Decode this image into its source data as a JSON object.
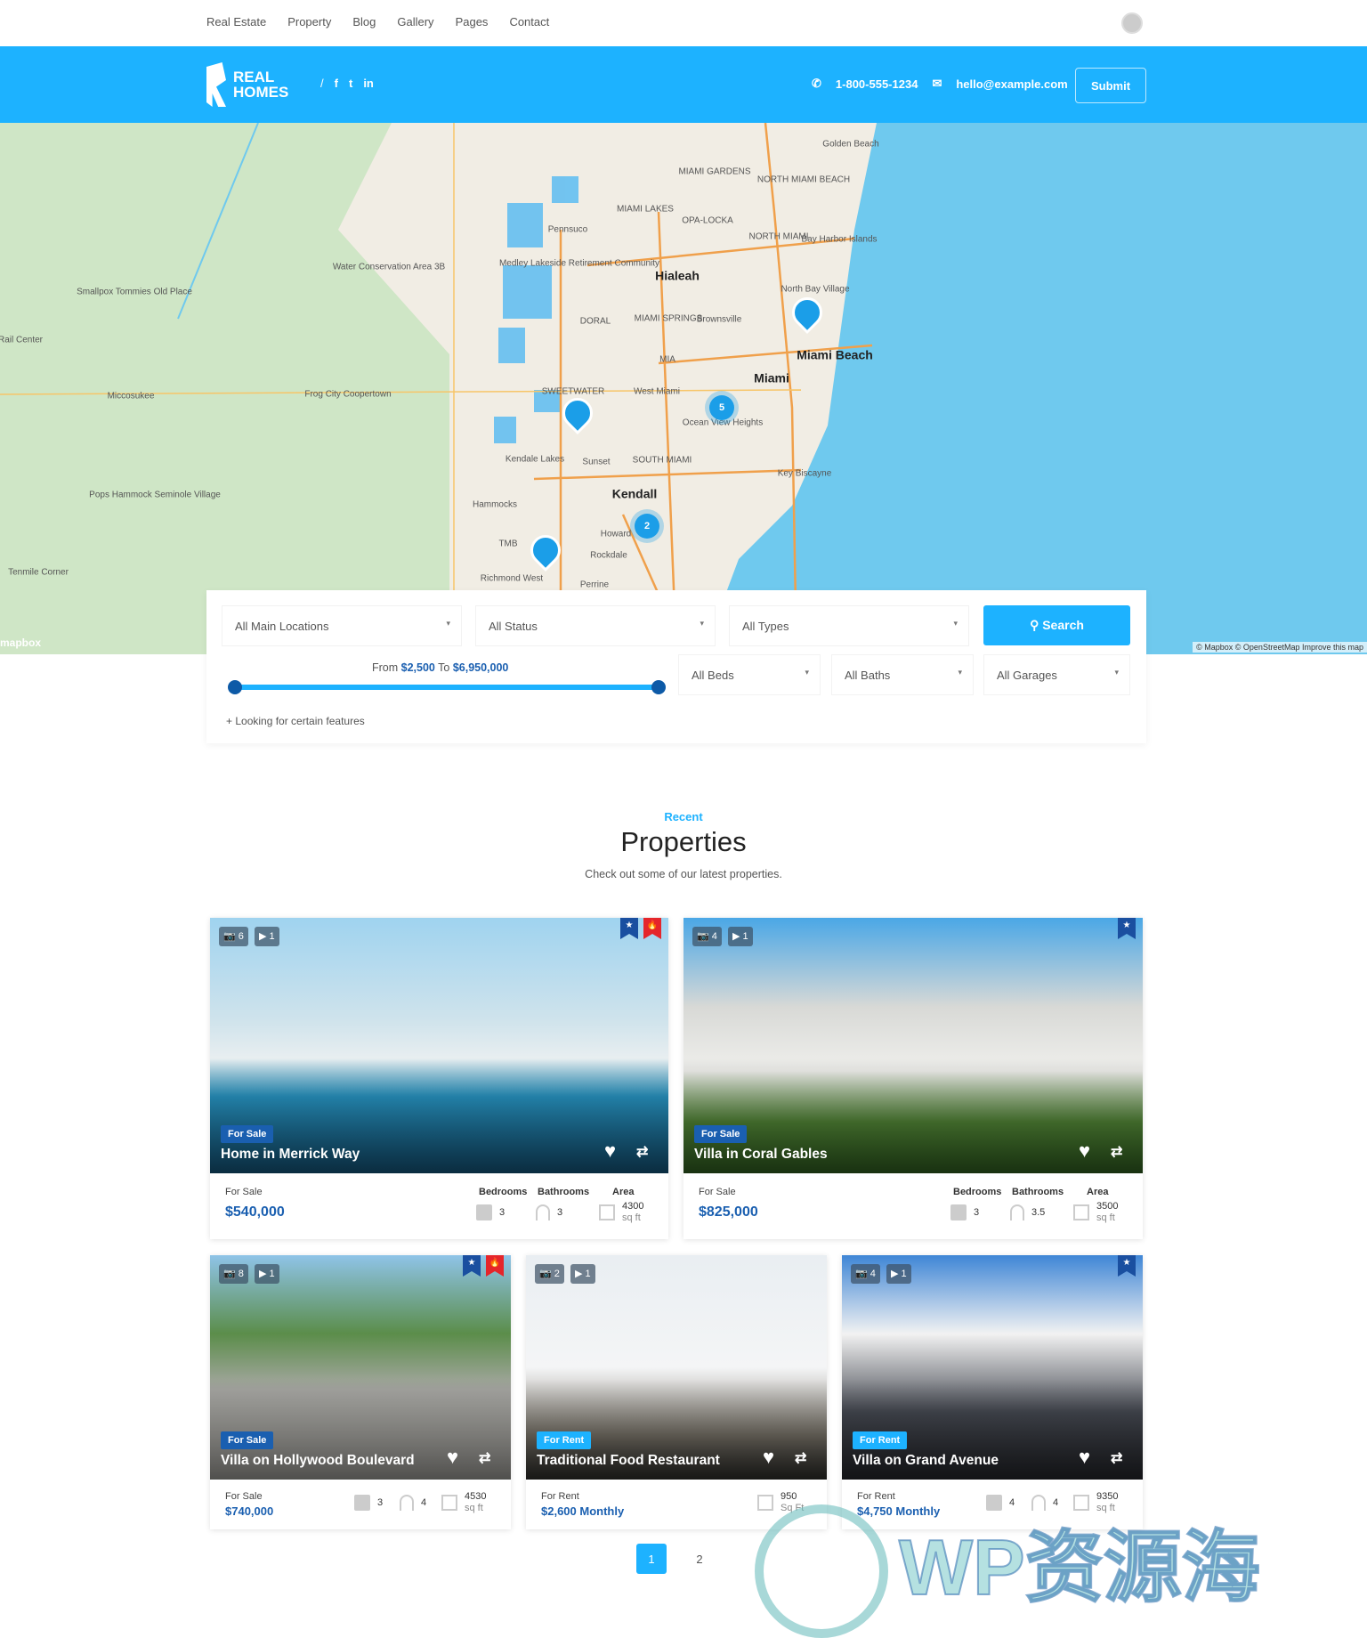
{
  "topnav": {
    "items": [
      "Real Estate",
      "Property",
      "Blog",
      "Gallery",
      "Pages",
      "Contact"
    ]
  },
  "header": {
    "logo_text": [
      "REAL",
      "HOMES"
    ],
    "social": [
      "facebook-icon",
      "twitter-icon",
      "linkedin-icon"
    ],
    "phone": "1-800-555-1234",
    "email": "hello@example.com",
    "submit": "Submit",
    "color": "#1db2ff"
  },
  "map": {
    "labels": [
      {
        "t": "Golden Beach"
      },
      {
        "t": "MIAMI GARDENS"
      },
      {
        "t": "NORTH MIAMI BEACH"
      },
      {
        "t": "MIAMI LAKES"
      },
      {
        "t": "OPA-LOCKA"
      },
      {
        "t": "Pennsuco"
      },
      {
        "t": "NORTH MIAMI"
      },
      {
        "t": "Bay Harbor Islands"
      },
      {
        "t": "Medley Lakeside Retirement Community"
      },
      {
        "t": "Water Conservation Area 3B"
      },
      {
        "t": "Hialeah"
      },
      {
        "t": "Smallpox Tommies Old Place"
      },
      {
        "t": "North Bay Village"
      },
      {
        "t": "MIAMI SPRINGS"
      },
      {
        "t": "Brownsville"
      },
      {
        "t": "DORAL"
      },
      {
        "t": "Rail Center"
      },
      {
        "t": "Miami Beach"
      },
      {
        "t": "Miami"
      },
      {
        "t": "MIA"
      },
      {
        "t": "West Miami"
      },
      {
        "t": "SWEETWATER"
      },
      {
        "t": "Miccosukee"
      },
      {
        "t": "Frog City Coopertown"
      },
      {
        "t": "Ocean View Heights"
      },
      {
        "t": "Kendale Lakes"
      },
      {
        "t": "Sunset"
      },
      {
        "t": "SOUTH MIAMI"
      },
      {
        "t": "Key Biscayne"
      },
      {
        "t": "Pops Hammock Seminole Village"
      },
      {
        "t": "Kendall"
      },
      {
        "t": "Hammocks"
      },
      {
        "t": "Howard"
      },
      {
        "t": "TMB"
      },
      {
        "t": "Rockdale"
      },
      {
        "t": "Tenmile Corner"
      },
      {
        "t": "Richmond West"
      },
      {
        "t": "Perrine"
      }
    ],
    "clusters": [
      "5",
      "2"
    ],
    "attribution": "© Mapbox © OpenStreetMap Improve this map",
    "brand": "mapbox"
  },
  "search": {
    "locations": "All Main Locations",
    "status": "All Status",
    "types": "All Types",
    "button": "Search",
    "range_from_label": "From",
    "range_min": "$2,500",
    "range_to_label": "To",
    "range_max": "$6,950,000",
    "beds": "All Beds",
    "baths": "All Baths",
    "garages": "All Garages",
    "features": "+ Looking for certain features"
  },
  "section": {
    "kicker": "Recent",
    "title": "Properties",
    "subtitle": "Check out some of our latest properties."
  },
  "labels": {
    "bedrooms": "Bedrooms",
    "bathrooms": "Bathrooms",
    "area": "Area"
  },
  "properties": [
    {
      "title": "Home in Merrick Way",
      "tag": "For Sale",
      "status": "For Sale",
      "price": "$540,000",
      "photos": "6",
      "videos": "1",
      "beds": "3",
      "baths": "3",
      "area": "4300",
      "unit": "sq ft",
      "featured": true,
      "hot": true
    },
    {
      "title": "Villa in Coral Gables",
      "tag": "For Sale",
      "status": "For Sale",
      "price": "$825,000",
      "photos": "4",
      "videos": "1",
      "beds": "3",
      "baths": "3.5",
      "area": "3500",
      "unit": "sq ft",
      "featured": true,
      "hot": false
    },
    {
      "title": "Villa on Hollywood Boulevard",
      "tag": "For Sale",
      "status": "For Sale",
      "price": "$740,000",
      "photos": "8",
      "videos": "1",
      "beds": "3",
      "baths": "4",
      "area": "4530",
      "unit": "sq ft",
      "featured": true,
      "hot": true
    },
    {
      "title": "Traditional Food Restaurant",
      "tag": "For Rent",
      "status": "For Rent",
      "price": "$2,600 Monthly",
      "photos": "2",
      "videos": "1",
      "beds": "",
      "baths": "",
      "area": "950",
      "unit": "Sq Ft",
      "featured": false,
      "hot": false
    },
    {
      "title": "Villa on Grand Avenue",
      "tag": "For Rent",
      "status": "For Rent",
      "price": "$4,750 Monthly",
      "photos": "4",
      "videos": "1",
      "beds": "4",
      "baths": "4",
      "area": "9350",
      "unit": "sq ft",
      "featured": true,
      "hot": false
    }
  ],
  "pagination": {
    "pages": [
      "1",
      "2"
    ],
    "current": "1"
  },
  "watermark": "WP资源海"
}
